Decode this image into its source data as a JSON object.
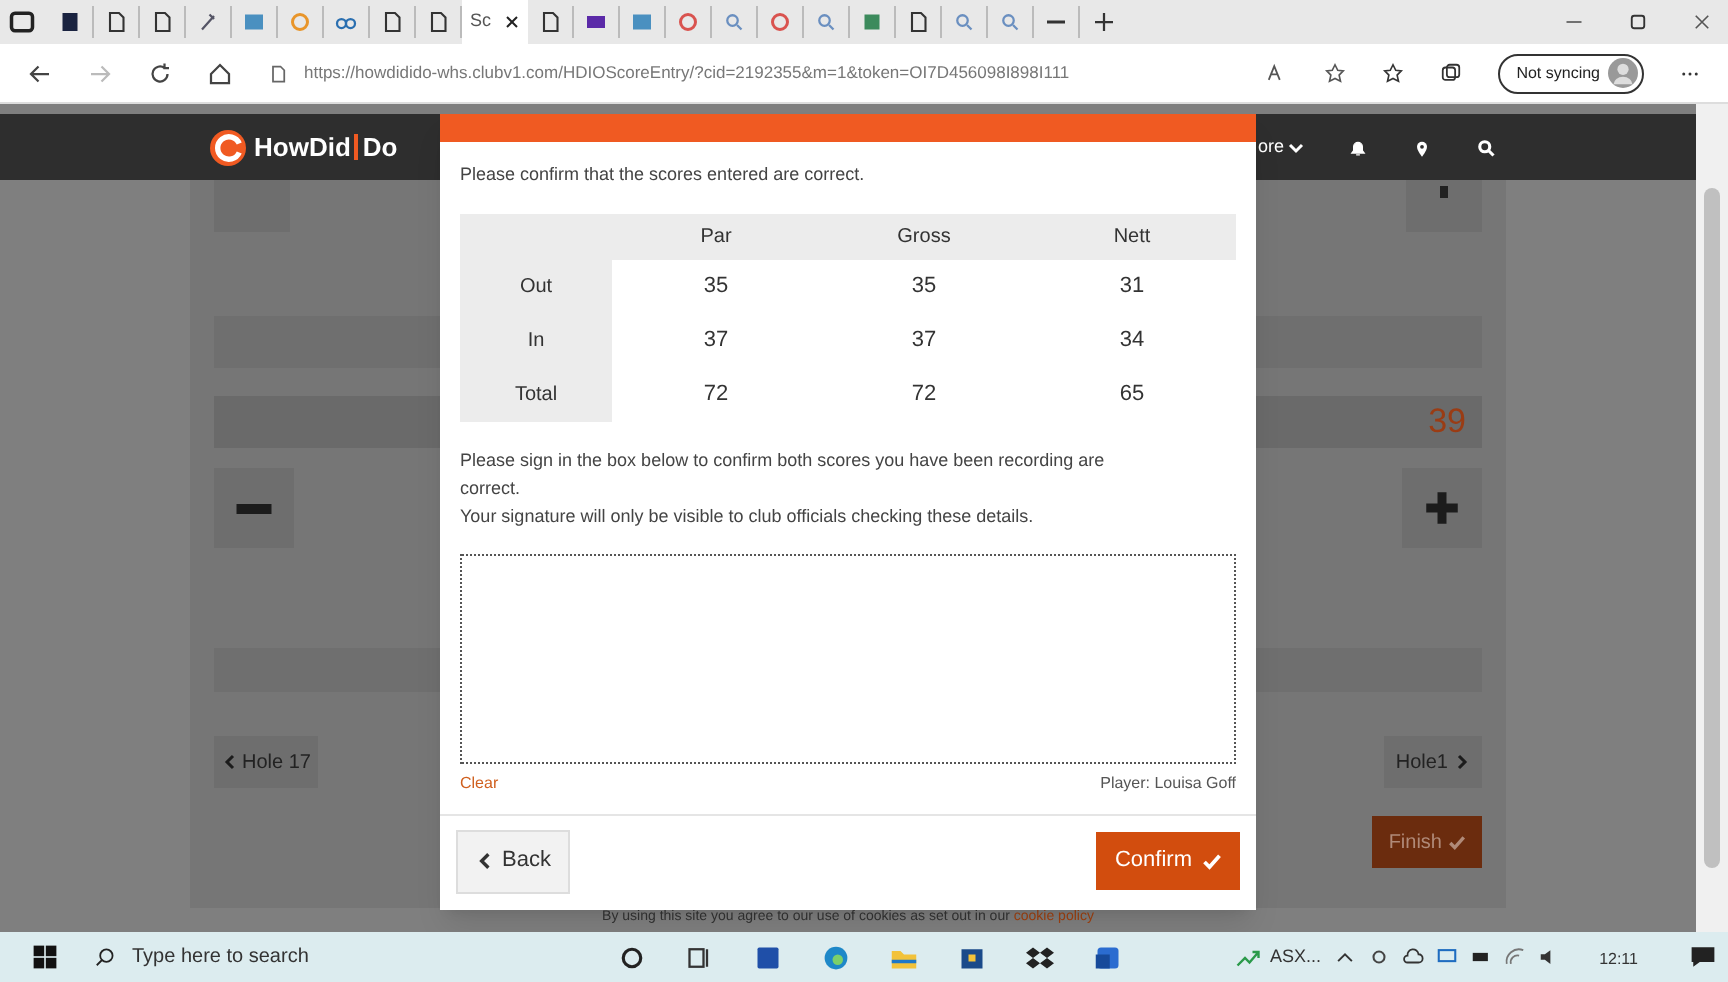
{
  "browser": {
    "tabs": [
      {
        "kind": "dark",
        "selected": false
      },
      {
        "kind": "doc",
        "selected": false
      },
      {
        "kind": "doc",
        "selected": false
      },
      {
        "kind": "pen",
        "selected": false
      },
      {
        "kind": "blue",
        "selected": false
      },
      {
        "kind": "orange",
        "selected": false
      },
      {
        "kind": "glasses",
        "selected": false
      },
      {
        "kind": "doc",
        "selected": false
      },
      {
        "kind": "doc",
        "selected": false
      },
      {
        "kind": "text",
        "label": "Sc",
        "selected": true
      },
      {
        "kind": "doc",
        "selected": false
      },
      {
        "kind": "mail",
        "selected": false
      },
      {
        "kind": "blue",
        "selected": false
      },
      {
        "kind": "red",
        "selected": false
      },
      {
        "kind": "search",
        "selected": false
      },
      {
        "kind": "red",
        "selected": false
      },
      {
        "kind": "search",
        "selected": false
      },
      {
        "kind": "green",
        "selected": false
      },
      {
        "kind": "doc",
        "selected": false
      },
      {
        "kind": "search",
        "selected": false
      },
      {
        "kind": "search",
        "selected": false
      },
      {
        "kind": "dash",
        "selected": false
      }
    ],
    "url": "https://howdidido-whs.clubv1.com/HDIOScoreEntry/?cid=2192355&m=1&token=OI7D456098I898I111",
    "sync": "Not syncing"
  },
  "site_header": {
    "logo": [
      "HowDid",
      "Do"
    ],
    "nav_partial": "ore"
  },
  "page": {
    "score": "39",
    "prev_hole": "Hole 17",
    "next_hole": "Hole1",
    "finish": "Finish",
    "cookie_notice": "By using this site you agree to our use of cookies as set out in our",
    "cookie_link": "cookie policy"
  },
  "dialog": {
    "intro": "Please confirm that the scores entered are correct.",
    "table": {
      "columns": [
        "Par",
        "Gross",
        "Nett"
      ],
      "rows": [
        {
          "label": "Out",
          "values": [
            "35",
            "35",
            "31"
          ]
        },
        {
          "label": "In",
          "values": [
            "37",
            "37",
            "34"
          ]
        },
        {
          "label": "Total",
          "values": [
            "72",
            "72",
            "65"
          ]
        }
      ]
    },
    "sign_text": "Please sign in the box below to confirm both scores you have been recording are correct.",
    "privacy_text": "Your signature will only be visible to club officials checking these details.",
    "clear": "Clear",
    "player": "Player: Louisa Goff",
    "back": "Back",
    "confirm": "Confirm"
  },
  "taskbar": {
    "search_placeholder": "Type here to search",
    "stocks": "ASX...",
    "time": "12:11"
  }
}
